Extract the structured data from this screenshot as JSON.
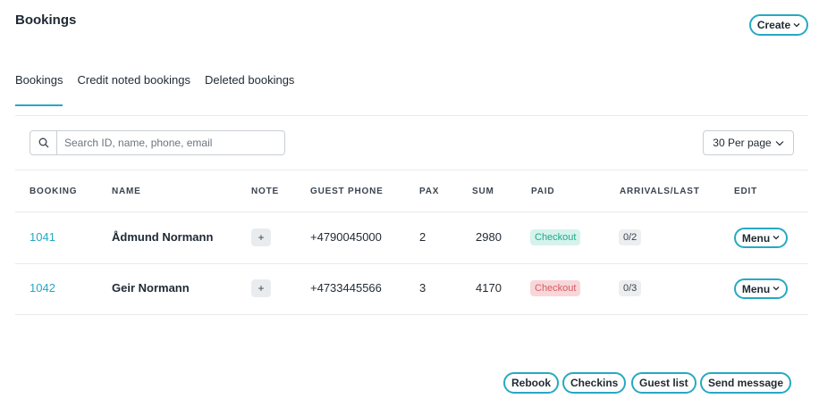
{
  "header": {
    "title": "Bookings",
    "create_label": "Create"
  },
  "tabs": [
    {
      "label": "Bookings",
      "active": true
    },
    {
      "label": "Credit noted bookings",
      "active": false
    },
    {
      "label": "Deleted bookings",
      "active": false
    }
  ],
  "search": {
    "placeholder": "Search ID, name, phone, email",
    "value": ""
  },
  "per_page": {
    "label": "30 Per page"
  },
  "table": {
    "columns": [
      "BOOKING",
      "NAME",
      "NOTE",
      "GUEST PHONE",
      "PAX",
      "SUM",
      "PAID",
      "ARRIVALS/LAST",
      "EDIT"
    ],
    "rows": [
      {
        "booking": "1041",
        "name": "Ådmund Normann",
        "note": "+",
        "phone": "+4790045000",
        "pax": "2",
        "sum": "2980",
        "paid": "Checkout",
        "paid_status": "paid",
        "arrivals": "0/2",
        "edit": "Menu"
      },
      {
        "booking": "1042",
        "name": "Geir Normann",
        "note": "+",
        "phone": "+4733445566",
        "pax": "3",
        "sum": "4170",
        "paid": "Checkout",
        "paid_status": "unpaid",
        "arrivals": "0/3",
        "edit": "Menu"
      }
    ]
  },
  "footer": {
    "rebook": "Rebook",
    "checkins": "Checkins",
    "guest_list": "Guest list",
    "send_message": "Send message"
  },
  "colors": {
    "accent": "#26a9c2",
    "paid_green": "#22a98a",
    "unpaid_red": "#d85a64"
  },
  "icons": {
    "search": "search-icon",
    "dropdown": "chevron-down-icon"
  }
}
